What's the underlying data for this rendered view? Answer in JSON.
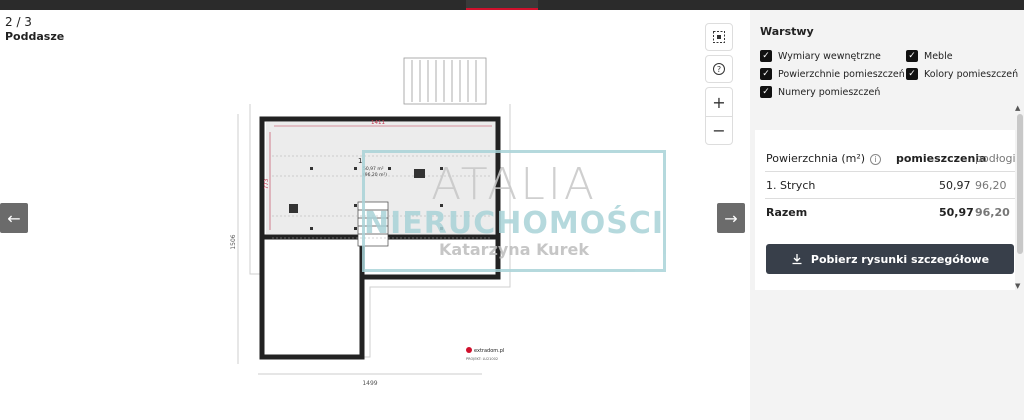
{
  "viewer": {
    "page_counter": "2 / 3",
    "floor_name": "Poddasze",
    "tools": {
      "fit_icon": "fit-screen-icon",
      "help_icon": "help-icon",
      "zoom_in": "+",
      "zoom_out": "−"
    },
    "nav": {
      "prev": "←",
      "next": "→"
    },
    "plan": {
      "dim_top": "1411",
      "dim_bottom": "1499",
      "dim_left": "1506",
      "dim_inner": "773",
      "room_number": "1",
      "room_area": "50,97 m²",
      "room_area_total": "(96,20 m²)",
      "brand": "extradom.pl",
      "project_code": "PROJEKT: LU21002"
    },
    "watermark": {
      "line1": "ATALIA",
      "line2": "NIERUCHOMOŚCI",
      "line3": "Katarzyna Kurek"
    }
  },
  "panel": {
    "layers_title": "Warstwy",
    "layers": [
      {
        "label": "Wymiary wewnętrzne",
        "checked": true
      },
      {
        "label": "Meble",
        "checked": true
      },
      {
        "label": "Powierzchnie pomieszczeń",
        "checked": true
      },
      {
        "label": "Kolory pomieszczeń",
        "checked": true
      },
      {
        "label": "Numery pomieszczeń",
        "checked": true
      }
    ],
    "table": {
      "headers": [
        "Powierzchnia (m²)",
        "pomieszczenia",
        "podłogi"
      ],
      "rows": [
        {
          "name": "1. Strych",
          "room": "50,97",
          "floor": "96,20"
        }
      ],
      "total": {
        "name": "Razem",
        "room": "50,97",
        "floor": "96,20"
      }
    },
    "download_label": "Pobierz rysunki szczegółowe"
  },
  "colors": {
    "accent": "#d0102c",
    "button_dark": "#383f4a",
    "watermark_teal": "#a9d3d8"
  }
}
